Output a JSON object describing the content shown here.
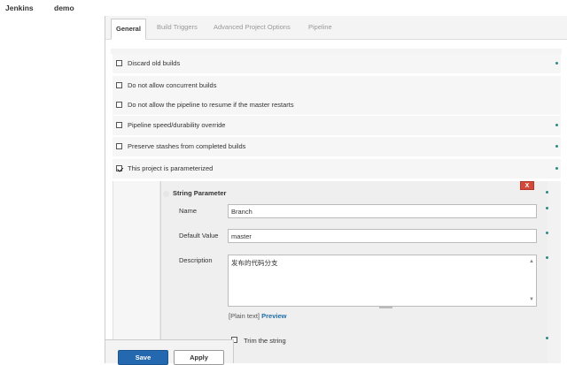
{
  "breadcrumb": {
    "items": [
      "Jenkins",
      "demo"
    ]
  },
  "tabs": [
    {
      "label": "General",
      "active": true
    },
    {
      "label": "Build Triggers",
      "active": false
    },
    {
      "label": "Advanced Project Options",
      "active": false
    },
    {
      "label": "Pipeline",
      "active": false
    }
  ],
  "options": [
    {
      "label": "Discard old builds",
      "checked": false
    },
    {
      "label": "Do not allow concurrent builds",
      "checked": false
    },
    {
      "label": "Do not allow the pipeline to resume if the master restarts",
      "checked": false
    },
    {
      "label": "Pipeline speed/durability override",
      "checked": false
    },
    {
      "label": "Preserve stashes from completed builds",
      "checked": false
    },
    {
      "label": "This project is parameterized",
      "checked": true
    }
  ],
  "parameter": {
    "title": "String Parameter",
    "delete_label": "X",
    "name_label": "Name",
    "name_value": "Branch",
    "default_label": "Default Value",
    "default_value": "master",
    "description_label": "Description",
    "description_value": "发布的代码分支",
    "format_text": "[Plain text]",
    "preview_link": "Preview",
    "trim_label": "Trim the string",
    "trim_checked": false
  },
  "footer": {
    "save_label": "Save",
    "apply_label": "Apply"
  },
  "colors": {
    "accent": "#2468b0",
    "help": "#2d8a8a",
    "delete": "#d24939",
    "link": "#1f6ea8"
  }
}
